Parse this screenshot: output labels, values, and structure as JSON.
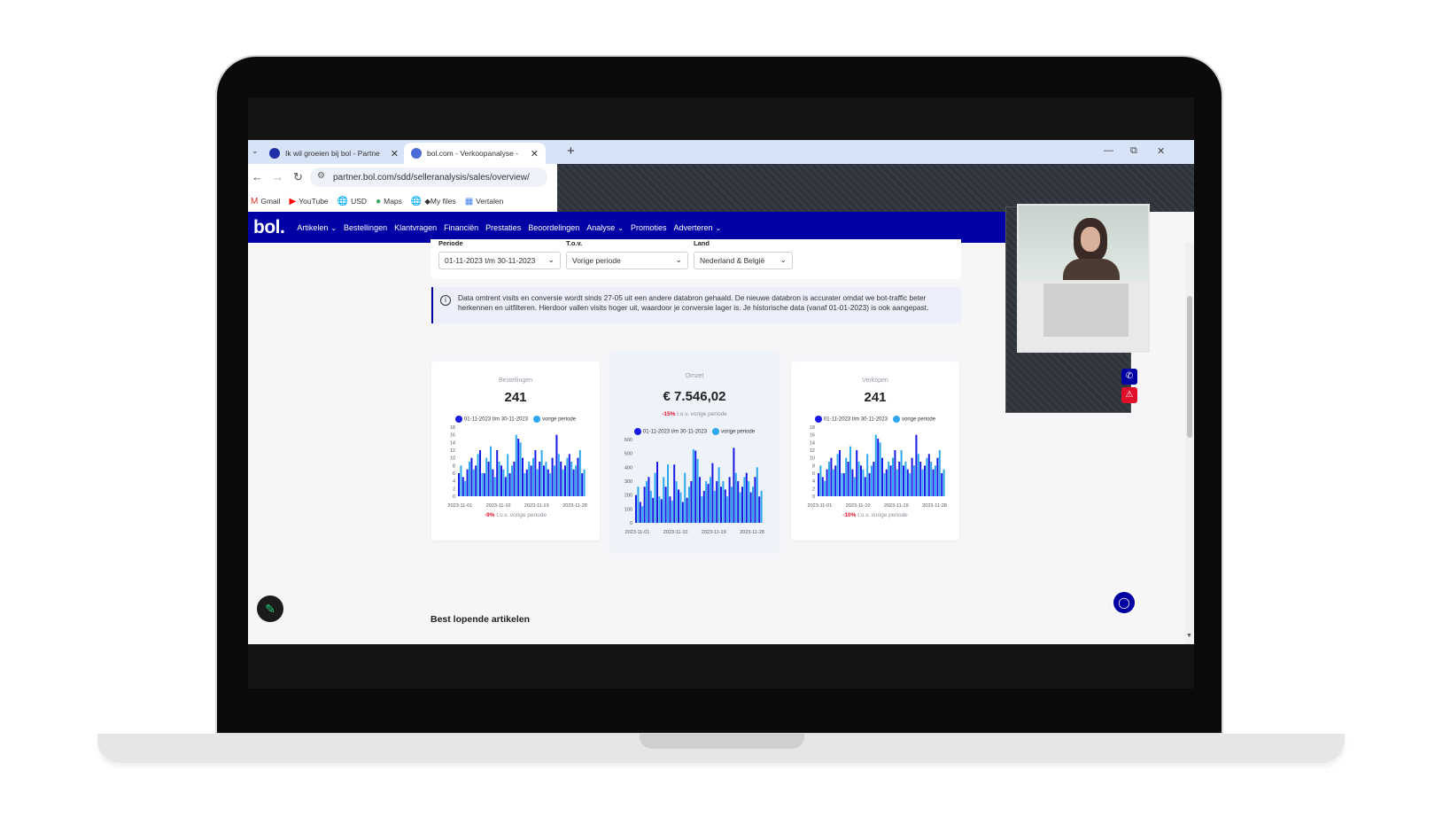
{
  "browser": {
    "tabs": [
      {
        "title": "Ik wil groeien bij bol - Partnerp",
        "active": false
      },
      {
        "title": "bol.com - Verkoopanalyse - ov",
        "active": true
      }
    ],
    "url": "partner.bol.com/sdd/selleranalysis/sales/overview/",
    "bookmarks": [
      {
        "label": "Gmail",
        "icon": "gmail-icon"
      },
      {
        "label": "YouTube",
        "icon": "youtube-icon"
      },
      {
        "label": "USD",
        "icon": "globe-icon"
      },
      {
        "label": "Maps",
        "icon": "maps-pin-icon"
      },
      {
        "label": "◆My files",
        "icon": "globe-icon"
      },
      {
        "label": "Vertalen",
        "icon": "translate-icon"
      }
    ]
  },
  "nav": {
    "logo": "bol.",
    "items": [
      {
        "label": "Artikelen",
        "dropdown": true
      },
      {
        "label": "Bestellingen",
        "dropdown": false
      },
      {
        "label": "Klantvragen",
        "dropdown": false
      },
      {
        "label": "Financiën",
        "dropdown": false
      },
      {
        "label": "Prestaties",
        "dropdown": false
      },
      {
        "label": "Beoordelingen",
        "dropdown": false
      },
      {
        "label": "Analyse",
        "dropdown": true
      },
      {
        "label": "Promoties",
        "dropdown": false
      },
      {
        "label": "Adverteren",
        "dropdown": true
      }
    ]
  },
  "filters": {
    "periode": {
      "label": "Periode",
      "value": "01-11-2023 t/m 30-11-2023"
    },
    "tov": {
      "label": "T.o.v.",
      "value": "Vorige periode"
    },
    "land": {
      "label": "Land",
      "value": "Nederland & België"
    }
  },
  "info": {
    "text": "Data omtrent visits en conversie wordt sinds 27-05 uit een andere databron gehaald. De nieuwe databron is accurater omdat we bot-traffic beter herkennen en uitfilteren. Hierdoor vallen visits hoger uit, waardoor je conversie lager is. Je historische data (vanaf 01-01-2023) is ook aangepast."
  },
  "kpis": [
    {
      "label": "Bestellingen",
      "value": "241",
      "delta": "-9%",
      "delta_suffix": "t.o.v. vorige periode"
    },
    {
      "label": "Omzet",
      "value": "€ 7.546,02",
      "delta": "-15%",
      "delta_suffix": "t.o.v. vorige periode"
    },
    {
      "label": "Verkopen",
      "value": "241",
      "delta": "-10%",
      "delta_suffix": "t.o.v. vorige periode"
    }
  ],
  "legend": {
    "current": "01-11-2023 t/m 30-11-2023",
    "previous": "vorige periode"
  },
  "colors": {
    "current": "#1a1ae6",
    "previous": "#2ea8f0",
    "brand": "#0000a4",
    "negative": "#e0102b"
  },
  "chart_data": [
    {
      "type": "bar",
      "title": "Bestellingen",
      "x_ticks": [
        "2023-11-01",
        "2023-11-10",
        "2023-11-19",
        "2023-11-28"
      ],
      "ylim": [
        0,
        18
      ],
      "y_ticks": [
        0,
        2,
        4,
        6,
        8,
        10,
        12,
        14,
        16,
        18
      ],
      "series": [
        {
          "name": "01-11-2023 t/m 30-11-2023",
          "values": [
            6,
            5,
            7,
            10,
            8,
            12,
            6,
            9,
            7,
            12,
            8,
            5,
            6,
            9,
            15,
            10,
            7,
            8,
            12,
            9,
            8,
            7,
            10,
            16,
            9,
            8,
            11,
            7,
            10,
            6
          ]
        },
        {
          "name": "vorige periode",
          "values": [
            8,
            4,
            9,
            7,
            11,
            6,
            10,
            13,
            5,
            9,
            7,
            11,
            8,
            16,
            14,
            6,
            9,
            10,
            7,
            12,
            9,
            6,
            8,
            11,
            7,
            10,
            9,
            8,
            12,
            7
          ]
        }
      ]
    },
    {
      "type": "bar",
      "title": "Omzet",
      "x_ticks": [
        "2023-11-01",
        "2023-11-10",
        "2023-11-19",
        "2023-11-28"
      ],
      "ylim": [
        0,
        600
      ],
      "y_ticks": [
        0,
        100,
        200,
        300,
        400,
        500,
        600
      ],
      "series": [
        {
          "name": "01-11-2023 t/m 30-11-2023",
          "values": [
            200,
            150,
            260,
            330,
            180,
            440,
            170,
            260,
            190,
            420,
            240,
            150,
            180,
            300,
            520,
            330,
            230,
            280,
            430,
            300,
            260,
            240,
            330,
            540,
            300,
            260,
            360,
            220,
            330,
            190
          ]
        },
        {
          "name": "vorige periode",
          "values": [
            260,
            120,
            300,
            230,
            360,
            190,
            330,
            420,
            160,
            300,
            220,
            360,
            260,
            530,
            460,
            190,
            300,
            330,
            230,
            400,
            300,
            190,
            260,
            360,
            220,
            330,
            300,
            260,
            400,
            230
          ]
        }
      ]
    },
    {
      "type": "bar",
      "title": "Verkopen",
      "x_ticks": [
        "2023-11-01",
        "2023-11-10",
        "2023-11-19",
        "2023-11-28"
      ],
      "ylim": [
        0,
        18
      ],
      "y_ticks": [
        0,
        2,
        4,
        6,
        8,
        10,
        12,
        14,
        16,
        18
      ],
      "series": [
        {
          "name": "01-11-2023 t/m 30-11-2023",
          "values": [
            6,
            5,
            7,
            10,
            8,
            12,
            6,
            9,
            7,
            12,
            8,
            5,
            6,
            9,
            15,
            10,
            7,
            8,
            12,
            9,
            8,
            7,
            10,
            16,
            9,
            8,
            11,
            7,
            10,
            6
          ]
        },
        {
          "name": "vorige periode",
          "values": [
            8,
            4,
            9,
            7,
            11,
            6,
            10,
            13,
            5,
            9,
            7,
            11,
            8,
            16,
            14,
            6,
            9,
            10,
            7,
            12,
            9,
            6,
            8,
            11,
            7,
            10,
            9,
            8,
            12,
            7
          ]
        }
      ]
    }
  ],
  "sections": {
    "best_selling": "Best lopende artikelen"
  }
}
